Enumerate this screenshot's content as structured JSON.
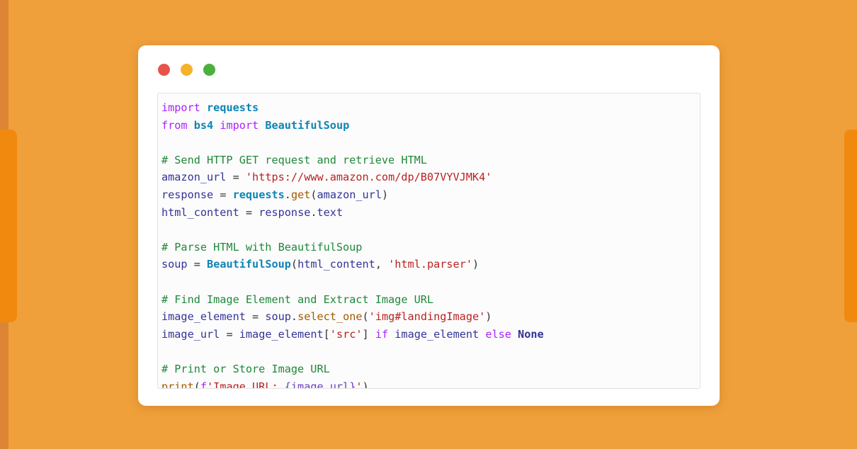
{
  "background": {
    "base_color": "#F0A03A",
    "stripe_color": "#DD8535",
    "tab_color": "#F1890F"
  },
  "window": {
    "background": "#FFFFFF",
    "controls": [
      {
        "name": "close",
        "color": "#E8544A"
      },
      {
        "name": "minimize",
        "color": "#F5B32A"
      },
      {
        "name": "maximize",
        "color": "#4CAF3E"
      }
    ]
  },
  "code_block": {
    "language": "python",
    "background": "#FCFCFC",
    "border_color": "#E2E2E2",
    "plain_text": "import requests\nfrom bs4 import BeautifulSoup\n\n# Send HTTP GET request and retrieve HTML\namazon_url = 'https://www.amazon.com/dp/B07VYVJMK4'\nresponse = requests.get(amazon_url)\nhtml_content = response.text\n\n# Parse HTML with BeautifulSoup\nsoup = BeautifulSoup(html_content, 'html.parser')\n\n# Find Image Element and Extract Image URL\nimage_element = soup.select_one('img#landingImage')\nimage_url = image_element['src'] if image_element else None\n\n# Print or Store Image URL\nprint(f'Image URL: {image_url}')",
    "lines": [
      {
        "id": 1,
        "text": "import requests",
        "tokens": [
          {
            "t": "import",
            "c": "kw"
          },
          {
            "t": " ",
            "c": "plain"
          },
          {
            "t": "requests",
            "c": "mod"
          }
        ]
      },
      {
        "id": 2,
        "text": "from bs4 import BeautifulSoup",
        "tokens": [
          {
            "t": "from",
            "c": "kw"
          },
          {
            "t": " ",
            "c": "plain"
          },
          {
            "t": "bs4",
            "c": "mod"
          },
          {
            "t": " ",
            "c": "plain"
          },
          {
            "t": "import",
            "c": "kw"
          },
          {
            "t": " ",
            "c": "plain"
          },
          {
            "t": "BeautifulSoup",
            "c": "class"
          }
        ]
      },
      {
        "id": 3,
        "text": "",
        "tokens": []
      },
      {
        "id": 4,
        "text": "# Send HTTP GET request and retrieve HTML",
        "tokens": [
          {
            "t": "# Send HTTP GET request and retrieve HTML",
            "c": "cmt"
          }
        ]
      },
      {
        "id": 5,
        "text": "amazon_url = 'https://www.amazon.com/dp/B07VYVJMK4'",
        "tokens": [
          {
            "t": "amazon_url",
            "c": "name"
          },
          {
            "t": " ",
            "c": "plain"
          },
          {
            "t": "=",
            "c": "op"
          },
          {
            "t": " ",
            "c": "plain"
          },
          {
            "t": "'https://www.amazon.com/dp/B07VYVJMK4'",
            "c": "str"
          }
        ]
      },
      {
        "id": 6,
        "text": "response = requests.get(amazon_url)",
        "tokens": [
          {
            "t": "response",
            "c": "name"
          },
          {
            "t": " ",
            "c": "plain"
          },
          {
            "t": "=",
            "c": "op"
          },
          {
            "t": " ",
            "c": "plain"
          },
          {
            "t": "requests",
            "c": "mod"
          },
          {
            "t": ".",
            "c": "punc"
          },
          {
            "t": "get",
            "c": "fn"
          },
          {
            "t": "(",
            "c": "punc"
          },
          {
            "t": "amazon_url",
            "c": "name"
          },
          {
            "t": ")",
            "c": "punc"
          }
        ]
      },
      {
        "id": 7,
        "text": "html_content = response.text",
        "tokens": [
          {
            "t": "html_content",
            "c": "name"
          },
          {
            "t": " ",
            "c": "plain"
          },
          {
            "t": "=",
            "c": "op"
          },
          {
            "t": " ",
            "c": "plain"
          },
          {
            "t": "response",
            "c": "name"
          },
          {
            "t": ".",
            "c": "punc"
          },
          {
            "t": "text",
            "c": "name"
          }
        ]
      },
      {
        "id": 8,
        "text": "",
        "tokens": []
      },
      {
        "id": 9,
        "text": "# Parse HTML with BeautifulSoup",
        "tokens": [
          {
            "t": "# Parse HTML with BeautifulSoup",
            "c": "cmt"
          }
        ]
      },
      {
        "id": 10,
        "text": "soup = BeautifulSoup(html_content, 'html.parser')",
        "tokens": [
          {
            "t": "soup",
            "c": "name"
          },
          {
            "t": " ",
            "c": "plain"
          },
          {
            "t": "=",
            "c": "op"
          },
          {
            "t": " ",
            "c": "plain"
          },
          {
            "t": "BeautifulSoup",
            "c": "class"
          },
          {
            "t": "(",
            "c": "punc"
          },
          {
            "t": "html_content",
            "c": "name"
          },
          {
            "t": ",",
            "c": "punc"
          },
          {
            "t": " ",
            "c": "plain"
          },
          {
            "t": "'html.parser'",
            "c": "str"
          },
          {
            "t": ")",
            "c": "punc"
          }
        ]
      },
      {
        "id": 11,
        "text": "",
        "tokens": []
      },
      {
        "id": 12,
        "text": "# Find Image Element and Extract Image URL",
        "tokens": [
          {
            "t": "# Find Image Element and Extract Image URL",
            "c": "cmt"
          }
        ]
      },
      {
        "id": 13,
        "text": "image_element = soup.select_one('img#landingImage')",
        "tokens": [
          {
            "t": "image_element",
            "c": "name"
          },
          {
            "t": " ",
            "c": "plain"
          },
          {
            "t": "=",
            "c": "op"
          },
          {
            "t": " ",
            "c": "plain"
          },
          {
            "t": "soup",
            "c": "name"
          },
          {
            "t": ".",
            "c": "punc"
          },
          {
            "t": "select_one",
            "c": "fn"
          },
          {
            "t": "(",
            "c": "punc"
          },
          {
            "t": "'img#landingImage'",
            "c": "str"
          },
          {
            "t": ")",
            "c": "punc"
          }
        ]
      },
      {
        "id": 14,
        "text": "image_url = image_element['src'] if image_element else None",
        "tokens": [
          {
            "t": "image_url",
            "c": "name"
          },
          {
            "t": " ",
            "c": "plain"
          },
          {
            "t": "=",
            "c": "op"
          },
          {
            "t": " ",
            "c": "plain"
          },
          {
            "t": "image_element",
            "c": "name"
          },
          {
            "t": "[",
            "c": "punc"
          },
          {
            "t": "'src'",
            "c": "str"
          },
          {
            "t": "]",
            "c": "punc"
          },
          {
            "t": " ",
            "c": "plain"
          },
          {
            "t": "if",
            "c": "kw"
          },
          {
            "t": " ",
            "c": "plain"
          },
          {
            "t": "image_element",
            "c": "name"
          },
          {
            "t": " ",
            "c": "plain"
          },
          {
            "t": "else",
            "c": "kw"
          },
          {
            "t": " ",
            "c": "plain"
          },
          {
            "t": "None",
            "c": "none"
          }
        ]
      },
      {
        "id": 15,
        "text": "",
        "tokens": []
      },
      {
        "id": 16,
        "text": "# Print or Store Image URL",
        "tokens": [
          {
            "t": "# Print or Store Image URL",
            "c": "cmt"
          }
        ]
      },
      {
        "id": 17,
        "text": "print(f'Image URL: {image_url}')",
        "tokens": [
          {
            "t": "print",
            "c": "builtin"
          },
          {
            "t": "(",
            "c": "punc"
          },
          {
            "t": "f",
            "c": "strpre"
          },
          {
            "t": "'Image URL: ",
            "c": "str"
          },
          {
            "t": "{image_url}",
            "c": "interp"
          },
          {
            "t": "'",
            "c": "str"
          },
          {
            "t": ")",
            "c": "punc"
          }
        ]
      }
    ]
  }
}
